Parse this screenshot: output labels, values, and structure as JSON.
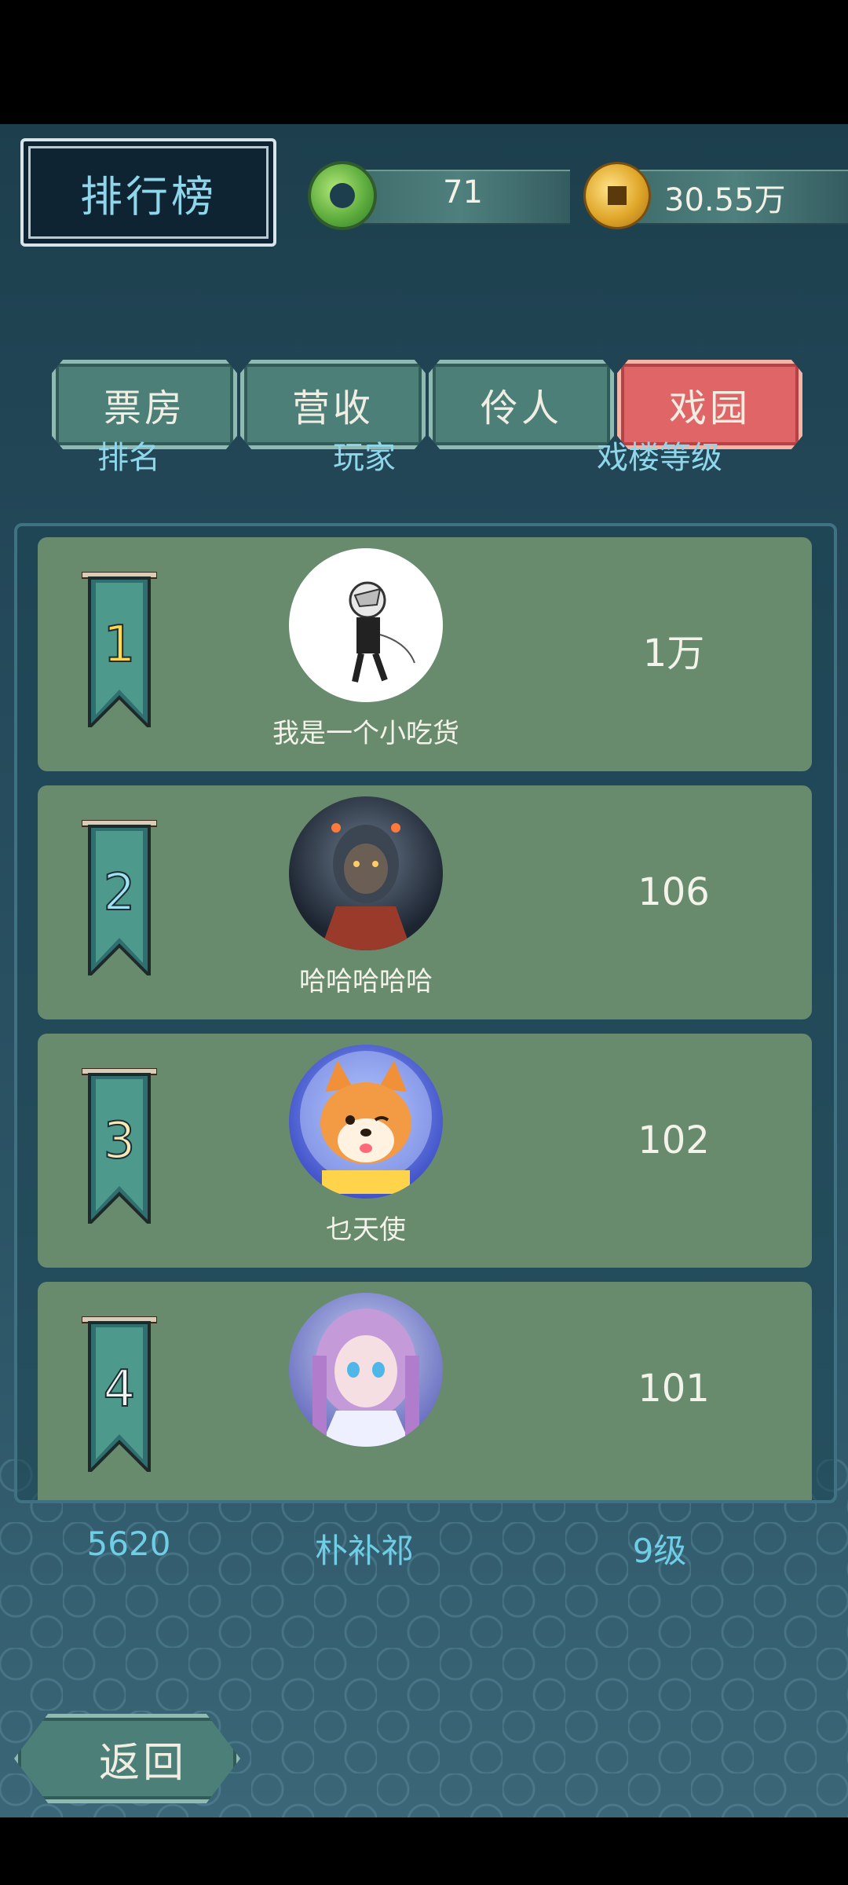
{
  "header": {
    "title": "排行榜",
    "jade_value": "71",
    "coin_value": "30.55万"
  },
  "tabs": [
    {
      "label": "票房",
      "active": false
    },
    {
      "label": "营收",
      "active": false
    },
    {
      "label": "伶人",
      "active": false
    },
    {
      "label": "戏园",
      "active": true
    }
  ],
  "columns": {
    "rank": "排名",
    "player": "玩家",
    "level": "戏楼等级"
  },
  "rows": [
    {
      "rank": "1",
      "name": "我是一个小吃货",
      "level": "1万"
    },
    {
      "rank": "2",
      "name": "哈哈哈哈哈",
      "level": "106"
    },
    {
      "rank": "3",
      "name": "乜天使",
      "level": "102"
    },
    {
      "rank": "4",
      "name": "",
      "level": "101"
    }
  ],
  "my_rank": {
    "rank": "5620",
    "name": "朴补祁",
    "level": "9级"
  },
  "footer": {
    "back_label": "返回"
  },
  "colors": {
    "accent_text": "#8fd6ea",
    "row_bg": "#688b6e",
    "active_tab": "#e06566"
  }
}
